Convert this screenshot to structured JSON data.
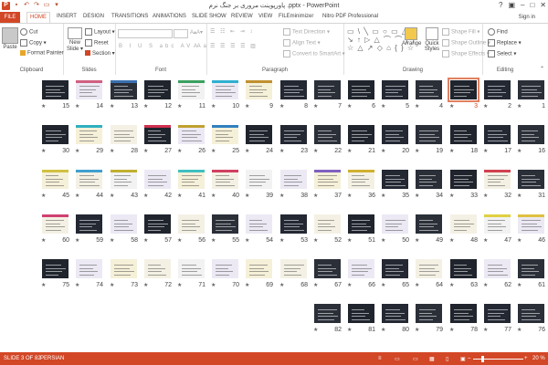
{
  "title": "پاورپوینت مروری بر جنگ نرم .pptx - PowerPoint",
  "signin": "Sign in",
  "tabs": [
    "FILE",
    "HOME",
    "INSERT",
    "DESIGN",
    "TRANSITIONS",
    "ANIMATIONS",
    "SLIDE SHOW",
    "REVIEW",
    "VIEW",
    "FILEminimizer",
    "Nitro PDF Professional"
  ],
  "clipboard": {
    "paste": "Paste",
    "cut": "Cut",
    "copy": "Copy",
    "format_painter": "Format Painter",
    "label": "Clipboard"
  },
  "slides_group": {
    "new_slide": "New Slide",
    "layout": "Layout",
    "reset": "Reset",
    "section": "Section",
    "label": "Slides"
  },
  "font_group": {
    "label": "Font"
  },
  "paragraph_group": {
    "text_direction": "Text Direction",
    "align_text": "Align Text",
    "convert_smartart": "Convert to SmartArt",
    "label": "Paragraph"
  },
  "drawing_group": {
    "arrange": "Arrange",
    "quick_styles": "Quick Styles",
    "shape_fill": "Shape Fill",
    "shape_outline": "Shape Outline",
    "shape_effects": "Shape Effects",
    "label": "Drawing"
  },
  "editing_group": {
    "find": "Find",
    "replace": "Replace",
    "select": "Select",
    "label": "Editing"
  },
  "status": {
    "slide": "SLIDE 3 OF 82",
    "language": "PERSIAN",
    "zoom": "20 %"
  },
  "selected_slide": 3,
  "slide_count": 82
}
